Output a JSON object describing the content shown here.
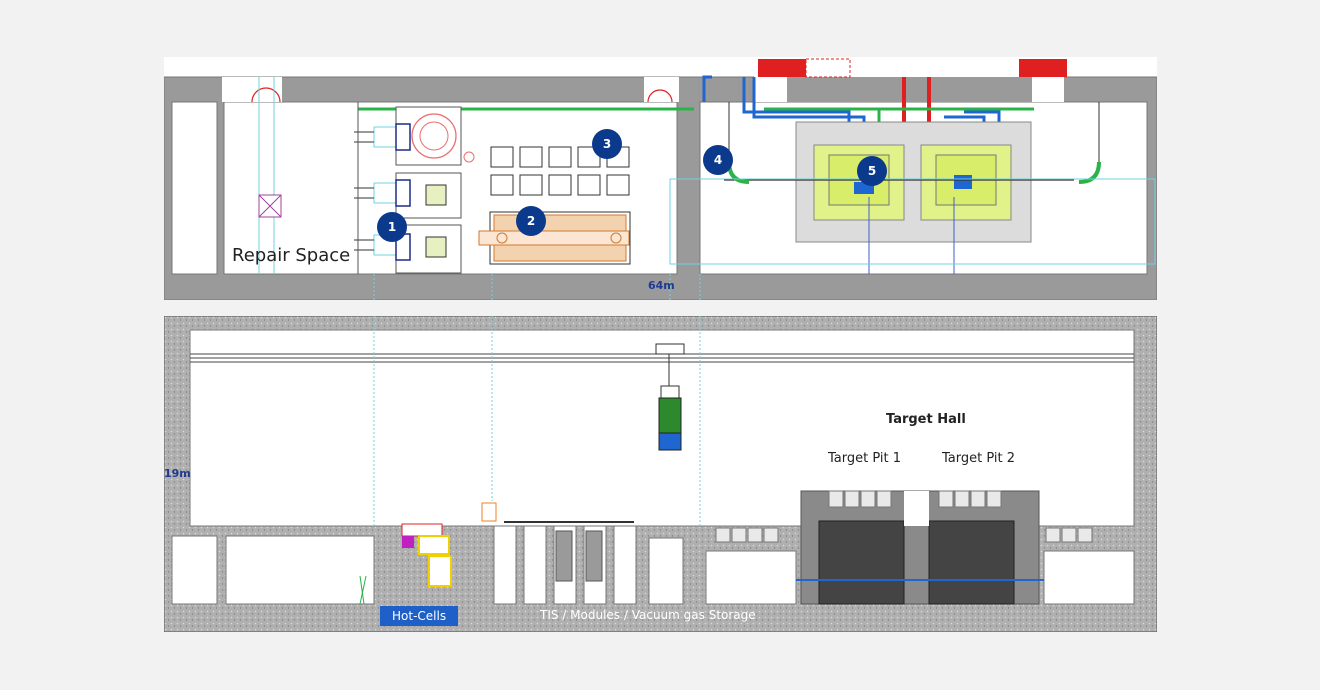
{
  "plan": {
    "repair_space_label": "Repair Space",
    "width_label": "64m"
  },
  "markers": [
    "1",
    "2",
    "3",
    "4",
    "5"
  ],
  "section": {
    "height_label": "19m",
    "hall_label": "Target Hall",
    "pit1_label": "Target Pit 1",
    "pit2_label": "Target Pit 2",
    "hotcells_label": "Hot-Cells",
    "storage_label": "TIS / Modules / Vacuum gas Storage"
  },
  "colors": {
    "concrete": "#999999",
    "marker": "#0b3a8c",
    "hotcell_tag": "#1f5fc8",
    "target_pad": "#e1f28a",
    "pipe_blue": "#1f66d1",
    "pipe_red": "#e02020",
    "pipe_green": "#2bb34a"
  }
}
